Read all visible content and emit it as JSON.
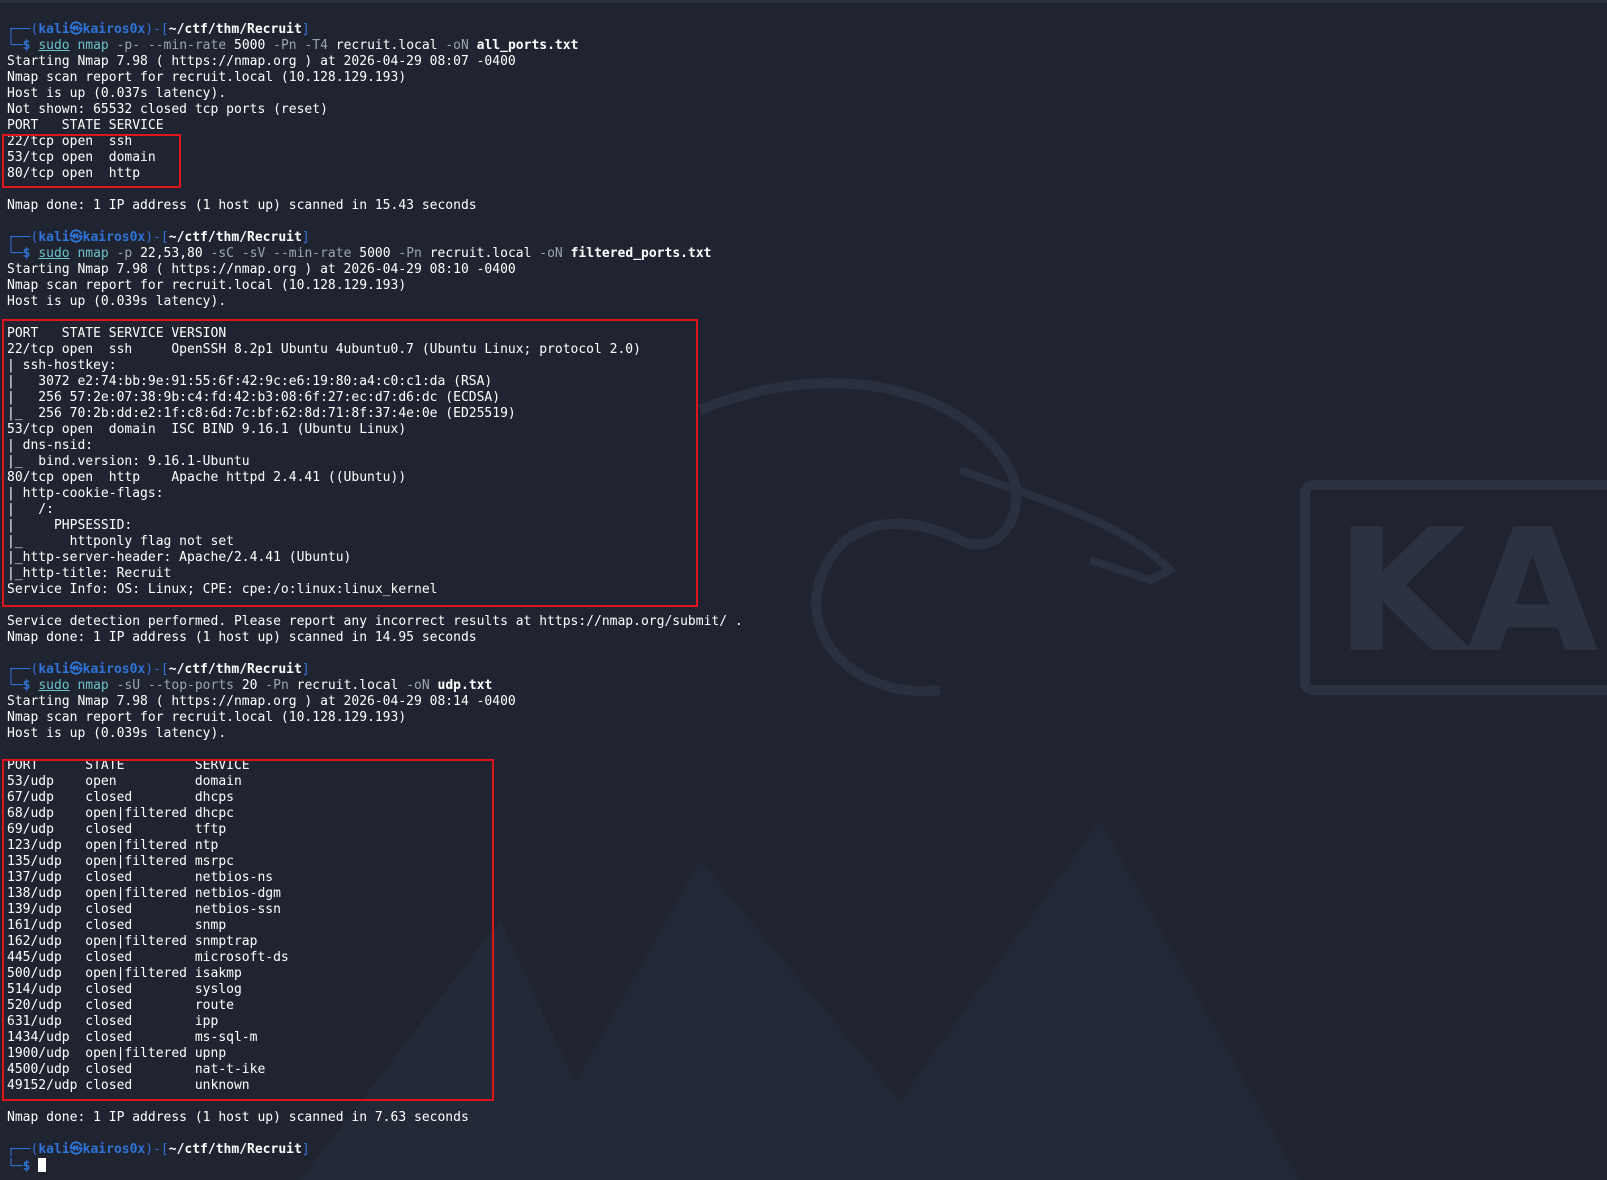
{
  "prompts": [
    {
      "user": "kali",
      "host": "kairos0x",
      "path": "~/ctf/thm/Recruit",
      "cmd": [
        {
          "t": "sudo",
          "k": "sudo"
        },
        {
          "t": " ",
          "k": "arg"
        },
        {
          "t": "nmap",
          "k": "cmd"
        },
        {
          "t": " -p- --min-rate ",
          "k": "flag"
        },
        {
          "t": "5000",
          "k": "arg"
        },
        {
          "t": " -Pn -T4 ",
          "k": "flag"
        },
        {
          "t": "recruit.local",
          "k": "arg"
        },
        {
          "t": " -oN ",
          "k": "flag"
        },
        {
          "t": "all_ports.txt",
          "k": "file"
        }
      ]
    },
    {
      "user": "kali",
      "host": "kairos0x",
      "path": "~/ctf/thm/Recruit",
      "cmd": [
        {
          "t": "sudo",
          "k": "sudo"
        },
        {
          "t": " ",
          "k": "arg"
        },
        {
          "t": "nmap",
          "k": "cmd"
        },
        {
          "t": " -p ",
          "k": "flag"
        },
        {
          "t": "22,53,80",
          "k": "arg"
        },
        {
          "t": " -sC -sV --min-rate ",
          "k": "flag"
        },
        {
          "t": "5000",
          "k": "arg"
        },
        {
          "t": " -Pn ",
          "k": "flag"
        },
        {
          "t": "recruit.local",
          "k": "arg"
        },
        {
          "t": " -oN ",
          "k": "flag"
        },
        {
          "t": "filtered_ports.txt",
          "k": "file"
        }
      ]
    },
    {
      "user": "kali",
      "host": "kairos0x",
      "path": "~/ctf/thm/Recruit",
      "cmd": [
        {
          "t": "sudo",
          "k": "sudo"
        },
        {
          "t": " ",
          "k": "arg"
        },
        {
          "t": "nmap",
          "k": "cmd"
        },
        {
          "t": " -sU --top-ports ",
          "k": "flag"
        },
        {
          "t": "20",
          "k": "arg"
        },
        {
          "t": " -Pn ",
          "k": "flag"
        },
        {
          "t": "recruit.local",
          "k": "arg"
        },
        {
          "t": " -oN ",
          "k": "flag"
        },
        {
          "t": "udp.txt",
          "k": "file"
        }
      ]
    },
    {
      "user": "kali",
      "host": "kairos0x",
      "path": "~/ctf/thm/Recruit",
      "cmd": [],
      "cursor": true
    }
  ],
  "output1": [
    "Starting Nmap 7.98 ( https://nmap.org ) at 2026-04-29 08:07 -0400",
    "Nmap scan report for recruit.local (10.128.129.193)",
    "Host is up (0.037s latency).",
    "Not shown: 65532 closed tcp ports (reset)",
    "PORT   STATE SERVICE",
    "22/tcp open  ssh",
    "53/tcp open  domain",
    "80/tcp open  http",
    "",
    "Nmap done: 1 IP address (1 host up) scanned in 15.43 seconds",
    ""
  ],
  "output2": [
    "Starting Nmap 7.98 ( https://nmap.org ) at 2026-04-29 08:10 -0400",
    "Nmap scan report for recruit.local (10.128.129.193)",
    "Host is up (0.039s latency).",
    "",
    "PORT   STATE SERVICE VERSION",
    "22/tcp open  ssh     OpenSSH 8.2p1 Ubuntu 4ubuntu0.7 (Ubuntu Linux; protocol 2.0)",
    "| ssh-hostkey:",
    "|   3072 e2:74:bb:9e:91:55:6f:42:9c:e6:19:80:a4:c0:c1:da (RSA)",
    "|   256 57:2e:07:38:9b:c4:fd:42:b3:08:6f:27:ec:d7:d6:dc (ECDSA)",
    "|_  256 70:2b:dd:e2:1f:c8:6d:7c:bf:62:8d:71:8f:37:4e:0e (ED25519)",
    "53/tcp open  domain  ISC BIND 9.16.1 (Ubuntu Linux)",
    "| dns-nsid:",
    "|_  bind.version: 9.16.1-Ubuntu",
    "80/tcp open  http    Apache httpd 2.4.41 ((Ubuntu))",
    "| http-cookie-flags:",
    "|   /:",
    "|     PHPSESSID:",
    "|_      httponly flag not set",
    "|_http-server-header: Apache/2.4.41 (Ubuntu)",
    "|_http-title: Recruit",
    "Service Info: OS: Linux; CPE: cpe:/o:linux:linux_kernel",
    "",
    "Service detection performed. Please report any incorrect results at https://nmap.org/submit/ .",
    "Nmap done: 1 IP address (1 host up) scanned in 14.95 seconds",
    ""
  ],
  "output3": [
    "Starting Nmap 7.98 ( https://nmap.org ) at 2026-04-29 08:14 -0400",
    "Nmap scan report for recruit.local (10.128.129.193)",
    "Host is up (0.039s latency).",
    "",
    "PORT      STATE         SERVICE",
    "53/udp    open          domain",
    "67/udp    closed        dhcps",
    "68/udp    open|filtered dhcpc",
    "69/udp    closed        tftp",
    "123/udp   open|filtered ntp",
    "135/udp   open|filtered msrpc",
    "137/udp   closed        netbios-ns",
    "138/udp   open|filtered netbios-dgm",
    "139/udp   closed        netbios-ssn",
    "161/udp   closed        snmp",
    "162/udp   open|filtered snmptrap",
    "445/udp   closed        microsoft-ds",
    "500/udp   open|filtered isakmp",
    "514/udp   closed        syslog",
    "520/udp   closed        route",
    "631/udp   closed        ipp",
    "1434/udp  closed        ms-sql-m",
    "1900/udp  open|filtered upnp",
    "4500/udp  closed        nat-t-ike",
    "49152/udp closed        unknown",
    "",
    "Nmap done: 1 IP address (1 host up) scanned in 7.63 seconds",
    ""
  ],
  "wallpaper": {
    "text": "KAL"
  },
  "colors": {
    "background": "#1f2430",
    "prompt": "#2f74d8",
    "command": "#6bc0c8",
    "highlight_box": "#e0141c"
  }
}
